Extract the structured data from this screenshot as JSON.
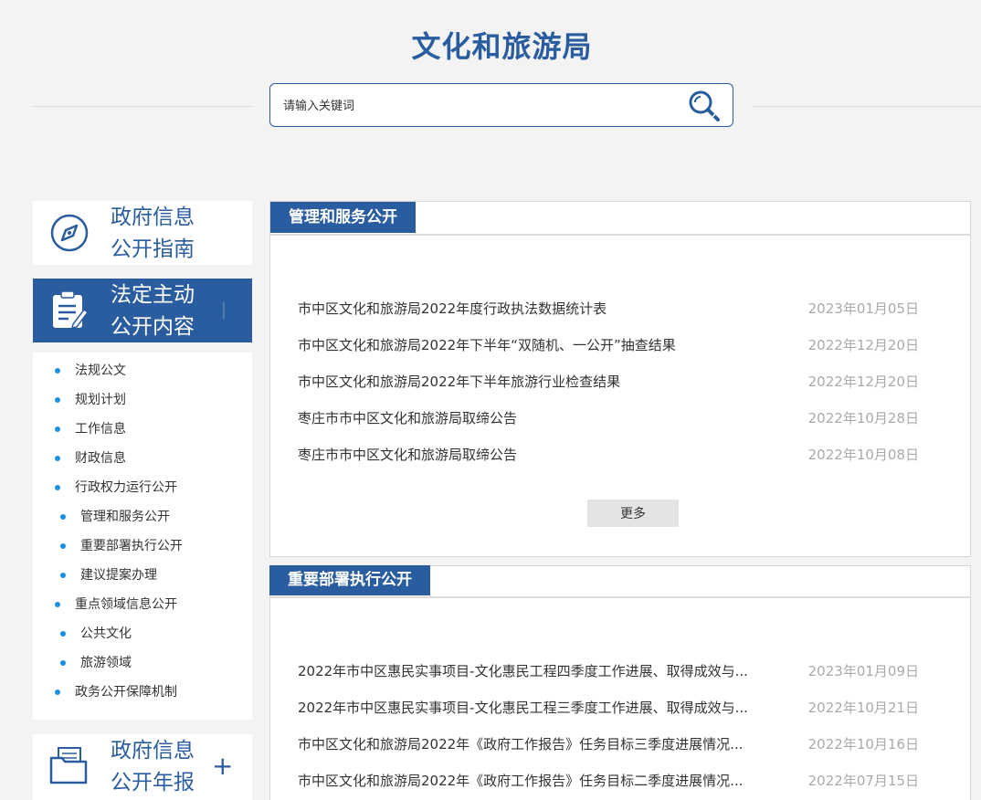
{
  "header": {
    "title": "文化和旅游局"
  },
  "search": {
    "placeholder": "请输入关键词"
  },
  "sidebar": {
    "guide": {
      "line1": "政府信息",
      "line2": "公开指南"
    },
    "active": {
      "line1": "法定主动",
      "line2": "公开内容"
    },
    "items": [
      "法规公文",
      "规划计划",
      "工作信息",
      "财政信息",
      "行政权力运行公开",
      "管理和服务公开",
      "重要部署执行公开",
      "建议提案办理",
      "重点领域信息公开",
      "公共文化",
      "旅游领域",
      "政务公开保障机制"
    ],
    "annual": {
      "line1": "政府信息",
      "line2": "公开年报",
      "expand": "+"
    }
  },
  "sections": [
    {
      "title": "管理和服务公开",
      "more_label": "更多",
      "rows": [
        {
          "title": "市中区文化和旅游局2022年度行政执法数据统计表",
          "date": "2023年01月05日"
        },
        {
          "title": "市中区文化和旅游局2022年下半年“双随机、一公开”抽查结果",
          "date": "2022年12月20日"
        },
        {
          "title": "市中区文化和旅游局2022年下半年旅游行业检查结果",
          "date": "2022年12月20日"
        },
        {
          "title": "枣庄市市中区文化和旅游局取缔公告",
          "date": "2022年10月28日"
        },
        {
          "title": "枣庄市市中区文化和旅游局取缔公告",
          "date": "2022年10月08日"
        }
      ]
    },
    {
      "title": "重要部署执行公开",
      "rows": [
        {
          "title": "2022年市中区惠民实事项目-文化惠民工程四季度工作进展、取得成效与...",
          "date": "2023年01月09日"
        },
        {
          "title": "2022年市中区惠民实事项目-文化惠民工程三季度工作进展、取得成效与...",
          "date": "2022年10月21日"
        },
        {
          "title": "市中区文化和旅游局2022年《政府工作报告》任务目标三季度进展情况...",
          "date": "2022年10月16日"
        },
        {
          "title": "市中区文化和旅游局2022年《政府工作报告》任务目标二季度进展情况...",
          "date": "2022年07月15日"
        }
      ]
    }
  ],
  "colors": {
    "brand": "#2a5d9f",
    "bullet": "#1a8fe0",
    "date": "#aaaaaa"
  }
}
